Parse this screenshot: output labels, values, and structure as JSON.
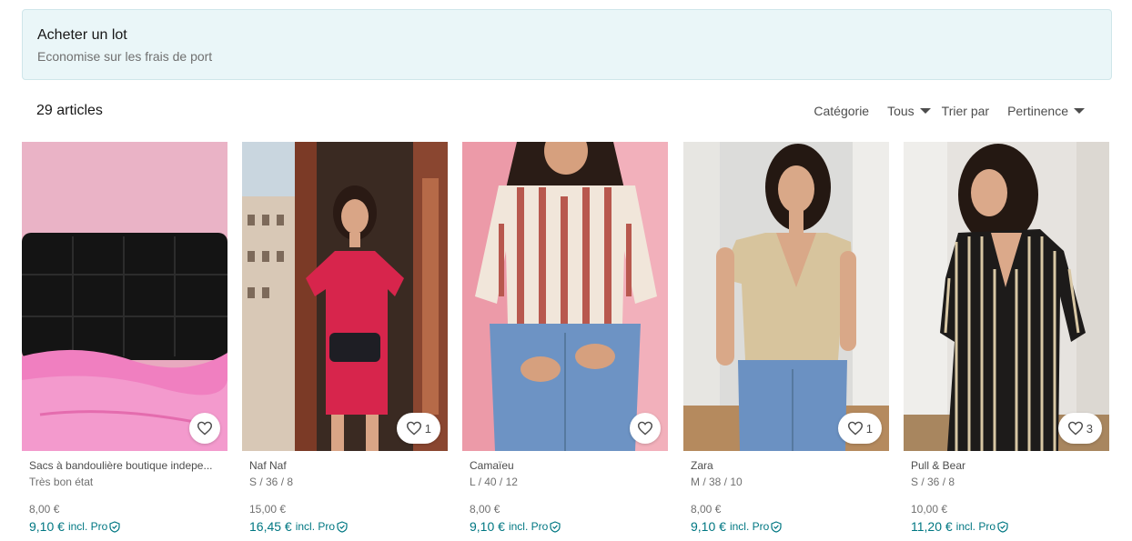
{
  "bundle": {
    "title": "Acheter un lot",
    "subtitle": "Economise sur les frais de port"
  },
  "toolbar": {
    "count": "29 articles",
    "category_label": "Catégorie",
    "category_value": "Tous",
    "sort_label": "Trier par",
    "sort_value": "Pertinence"
  },
  "colors": {
    "accent": "#007782",
    "banner_bg": "#eaf6f8"
  },
  "products": [
    {
      "title": "Sacs à bandoulière boutique indepe...",
      "subtitle": "Très bon état",
      "price": "8,00 €",
      "pro_price": "9,10 €",
      "pro_note": "incl. Pro",
      "favorites": ""
    },
    {
      "title": "Naf Naf",
      "subtitle": "S / 36 / 8",
      "price": "15,00 €",
      "pro_price": "16,45 €",
      "pro_note": "incl. Pro",
      "favorites": "1"
    },
    {
      "title": "Camaïeu",
      "subtitle": "L / 40 / 12",
      "price": "8,00 €",
      "pro_price": "9,10 €",
      "pro_note": "incl. Pro",
      "favorites": ""
    },
    {
      "title": "Zara",
      "subtitle": "M / 38 / 10",
      "price": "8,00 €",
      "pro_price": "9,10 €",
      "pro_note": "incl. Pro",
      "favorites": "1"
    },
    {
      "title": "Pull & Bear",
      "subtitle": "S / 36 / 8",
      "price": "10,00 €",
      "pro_price": "11,20 €",
      "pro_note": "incl. Pro",
      "favorites": "3"
    }
  ]
}
